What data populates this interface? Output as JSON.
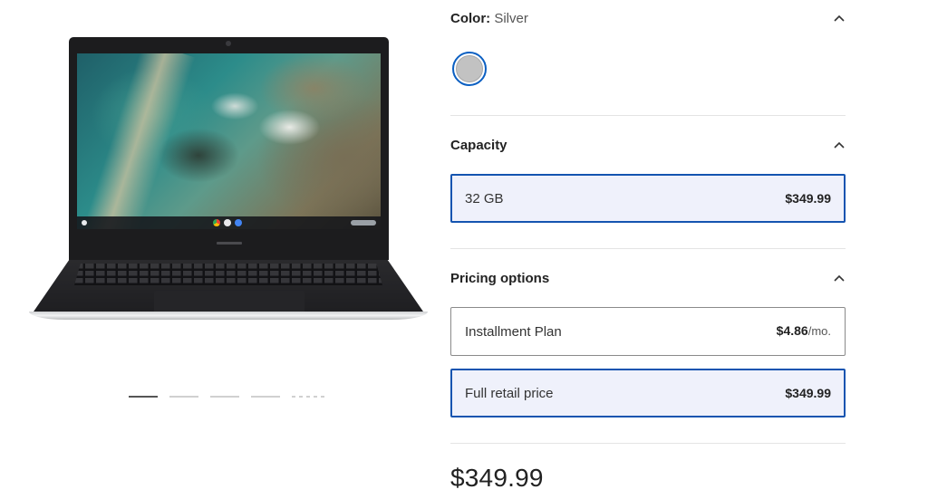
{
  "color_section": {
    "title": "Color",
    "separator": ":",
    "selected_value": "Silver",
    "swatches": [
      {
        "name": "Silver",
        "hex": "#c2c2c2",
        "selected": true
      }
    ]
  },
  "capacity_section": {
    "title": "Capacity",
    "options": [
      {
        "label": "32 GB",
        "price": "$349.99",
        "selected": true
      }
    ]
  },
  "pricing_section": {
    "title": "Pricing options",
    "options": [
      {
        "label": "Installment Plan",
        "price": "$4.86",
        "unit": "/mo.",
        "selected": false
      },
      {
        "label": "Full retail price",
        "price": "$349.99",
        "unit": "",
        "selected": true
      }
    ]
  },
  "total_price": "$349.99",
  "gallery": {
    "slide_count": 4,
    "active_index": 0
  },
  "icons": {
    "section_toggle": "chevron-up-icon"
  },
  "colors": {
    "accent_border": "#1454b0",
    "selected_bg": "#eff1fb",
    "swatch_ring": "#0b5fc2"
  }
}
